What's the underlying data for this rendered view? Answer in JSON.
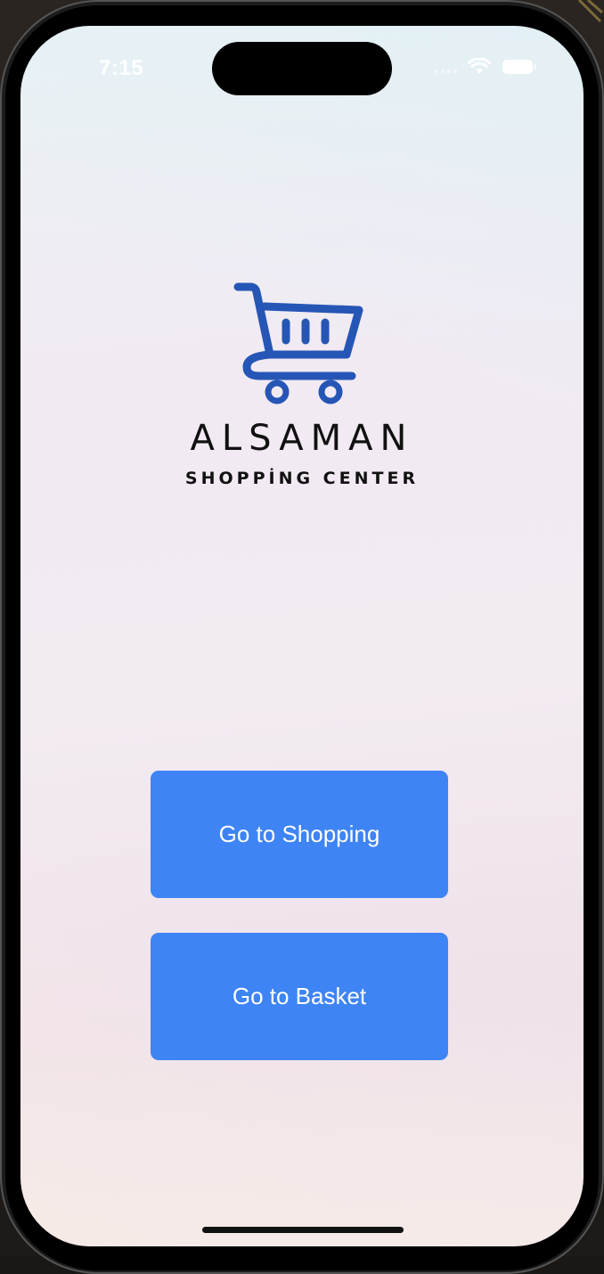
{
  "status_bar": {
    "time": "7:15",
    "icons": [
      "cellular-signal-icon",
      "wifi-icon",
      "battery-icon"
    ]
  },
  "brand": {
    "logo_icon": "shopping-cart-icon",
    "name": "ALSAMAN",
    "tagline": "SHOPPİNG CENTER",
    "logo_color": "#2656b5"
  },
  "actions": {
    "shopping_label": "Go to Shopping",
    "basket_label": "Go to Basket",
    "button_color": "#3e84f5"
  }
}
